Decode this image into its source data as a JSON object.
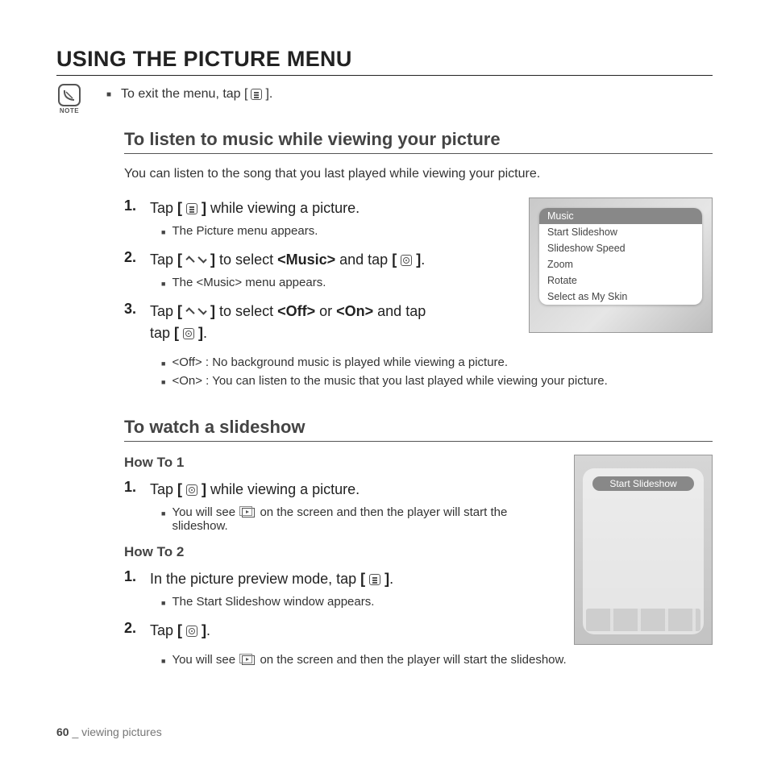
{
  "page": {
    "title": "USING THE PICTURE MENU",
    "note_label": "NOTE",
    "note_text_pre": "To exit the menu, tap [",
    "note_text_post": "].",
    "page_number": "60",
    "footer_section": "viewing pictures"
  },
  "section1": {
    "heading": "To listen to music while viewing your picture",
    "intro": "You can listen to the song that you last played while viewing your picture.",
    "steps": [
      {
        "num": "1.",
        "pre": "Tap ",
        "icon": "menu",
        "post": " while viewing a picture.",
        "subs": [
          "The Picture menu appears."
        ]
      },
      {
        "num": "2.",
        "pre": "Tap ",
        "icon": "updown",
        "mid": " to select ",
        "bold1": "<Music>",
        "post1": " and tap ",
        "icon2": "circle",
        "post2": ".",
        "subs": [
          "The <Music> menu appears."
        ]
      },
      {
        "num": "3.",
        "pre": "Tap ",
        "icon": "updown",
        "mid": " to select ",
        "bold1": "<Off>",
        "mid2": " or ",
        "bold2": "<On>",
        "post1": " and tap ",
        "icon2": "circle",
        "post2": ".",
        "subs": [
          "<Off> : No background music is played while viewing a picture.",
          "<On> : You can listen to the music that you last played while viewing your picture."
        ]
      }
    ],
    "device_menu": {
      "items": [
        "Music",
        "Start Slideshow",
        "Slideshow Speed",
        "Zoom",
        "Rotate",
        "Select as My Skin"
      ],
      "selected_index": 0
    }
  },
  "section2": {
    "heading": "To watch a slideshow",
    "howto1": "How To 1",
    "howto1_steps": [
      {
        "num": "1.",
        "pre": "Tap ",
        "icon": "circle",
        "post": " while viewing a picture.",
        "subs": [
          "You will see __SLIDE__ on the screen and then the player will start the slideshow."
        ]
      }
    ],
    "howto2": "How To 2",
    "howto2_steps": [
      {
        "num": "1.",
        "pre": "In the picture preview mode, tap ",
        "icon": "menu",
        "post": ".",
        "subs": [
          "The Start Slideshow window appears."
        ]
      },
      {
        "num": "2.",
        "pre": "Tap ",
        "icon": "circle",
        "post": ".",
        "subs": [
          "You will see __SLIDE__ on the screen and then the player will start the slideshow."
        ]
      }
    ],
    "device_label": "Start Slideshow"
  }
}
